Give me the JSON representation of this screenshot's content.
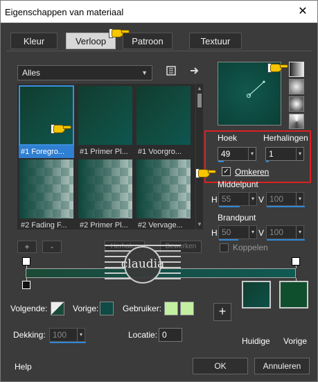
{
  "window": {
    "title": "Eigenschappen van materiaal",
    "close_glyph": "✕"
  },
  "tabs": [
    {
      "label": "Kleur",
      "active": false
    },
    {
      "label": "Verloop",
      "active": true
    },
    {
      "label": "Patroon",
      "active": false
    },
    {
      "label": "Textuur",
      "active": false
    }
  ],
  "gallery": {
    "category": "Alles",
    "items": [
      {
        "label": "#1 Foregro...",
        "style": "dark",
        "selected": true
      },
      {
        "label": "#1 Primer Pl...",
        "style": "dark",
        "selected": false
      },
      {
        "label": "#1 Voorgro...",
        "style": "dark",
        "selected": false
      },
      {
        "label": "#2 Fading F...",
        "style": "check",
        "selected": false
      },
      {
        "label": "#2 Primer Pl...",
        "style": "check",
        "selected": false
      },
      {
        "label": "#2 Vervage...",
        "style": "check",
        "selected": false
      }
    ]
  },
  "angle": {
    "label": "Hoek",
    "value": "49",
    "fill": 0.14
  },
  "repeats": {
    "label": "Herhalingen",
    "value": "1",
    "fill": 0.05
  },
  "invert": {
    "label": "Omkeren",
    "checked": true
  },
  "midpoint": {
    "label": "Middelpunt",
    "h_label": "H",
    "h_value": "55",
    "v_label": "V",
    "v_value": "100"
  },
  "focal": {
    "label": "Brandpunt",
    "h_label": "H",
    "h_value": "50",
    "v_label": "V",
    "v_value": "100"
  },
  "link": {
    "label": "Koppelen",
    "checked": false
  },
  "editor": {
    "add_label": "+",
    "remove_label": "-",
    "hidden_btn_1": "Herhalen",
    "hidden_btn_2": "Bewerken"
  },
  "watermark_text": "claudia",
  "bottom": {
    "volgende_label": "Volgende:",
    "vorige_label": "Vorige:",
    "gebruiker_label": "Gebruiker:",
    "dekking_label": "Dekking:",
    "dekking_value": "100",
    "dekking_fill": 1.0,
    "locatie_label": "Locatie:",
    "locatie_value": "0",
    "add_glyph": "+",
    "huidige_label": "Huidige",
    "vorige_swatch_label": "Vorige"
  },
  "buttons": {
    "help": "Help",
    "ok": "OK",
    "cancel": "Annuleren"
  },
  "colors": {
    "gradient_dark": "#103d2f",
    "gradient_teal": "#0d5650",
    "user_color": "#c2f0a0",
    "selection_blue": "#2f7fd2",
    "highlight_red": "#e02020",
    "pointer_yellow": "#f6c600"
  }
}
